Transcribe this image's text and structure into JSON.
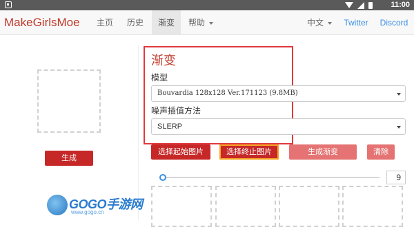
{
  "status_bar": {
    "time": "11:00",
    "icons": [
      "app-icon",
      "wifi-icon",
      "signal-icon",
      "battery-icon"
    ]
  },
  "navbar": {
    "brand": "MakeGirlsMoe",
    "items": [
      {
        "label": "主页"
      },
      {
        "label": "历史"
      },
      {
        "label": "渐变",
        "active": true
      },
      {
        "label": "帮助"
      }
    ],
    "language": "中文",
    "links": [
      "Twitter",
      "Discord"
    ]
  },
  "left": {
    "generate_label": "生成"
  },
  "interp": {
    "title": "渐变",
    "model_label": "模型",
    "model_value": "Bouvardia 128x128 Ver.171123 (9.8MB)",
    "noise_label": "噪声插值方法",
    "noise_value": "SLERP"
  },
  "buttons": {
    "select_start": "选择起始图片",
    "select_end": "选择终止图片",
    "generate_interp": "生成渐变",
    "clear": "清除"
  },
  "slider": {
    "value_fraction": 0.0,
    "steps": "9"
  },
  "watermark": {
    "logo_text": "GOGO手游网",
    "url": "www.gogo.cn"
  },
  "colors": {
    "brand": "#c0392b",
    "primary_button": "#c62828",
    "light_button": "#e57373",
    "highlight": "#e0393e",
    "link": "#3a8ee6"
  }
}
